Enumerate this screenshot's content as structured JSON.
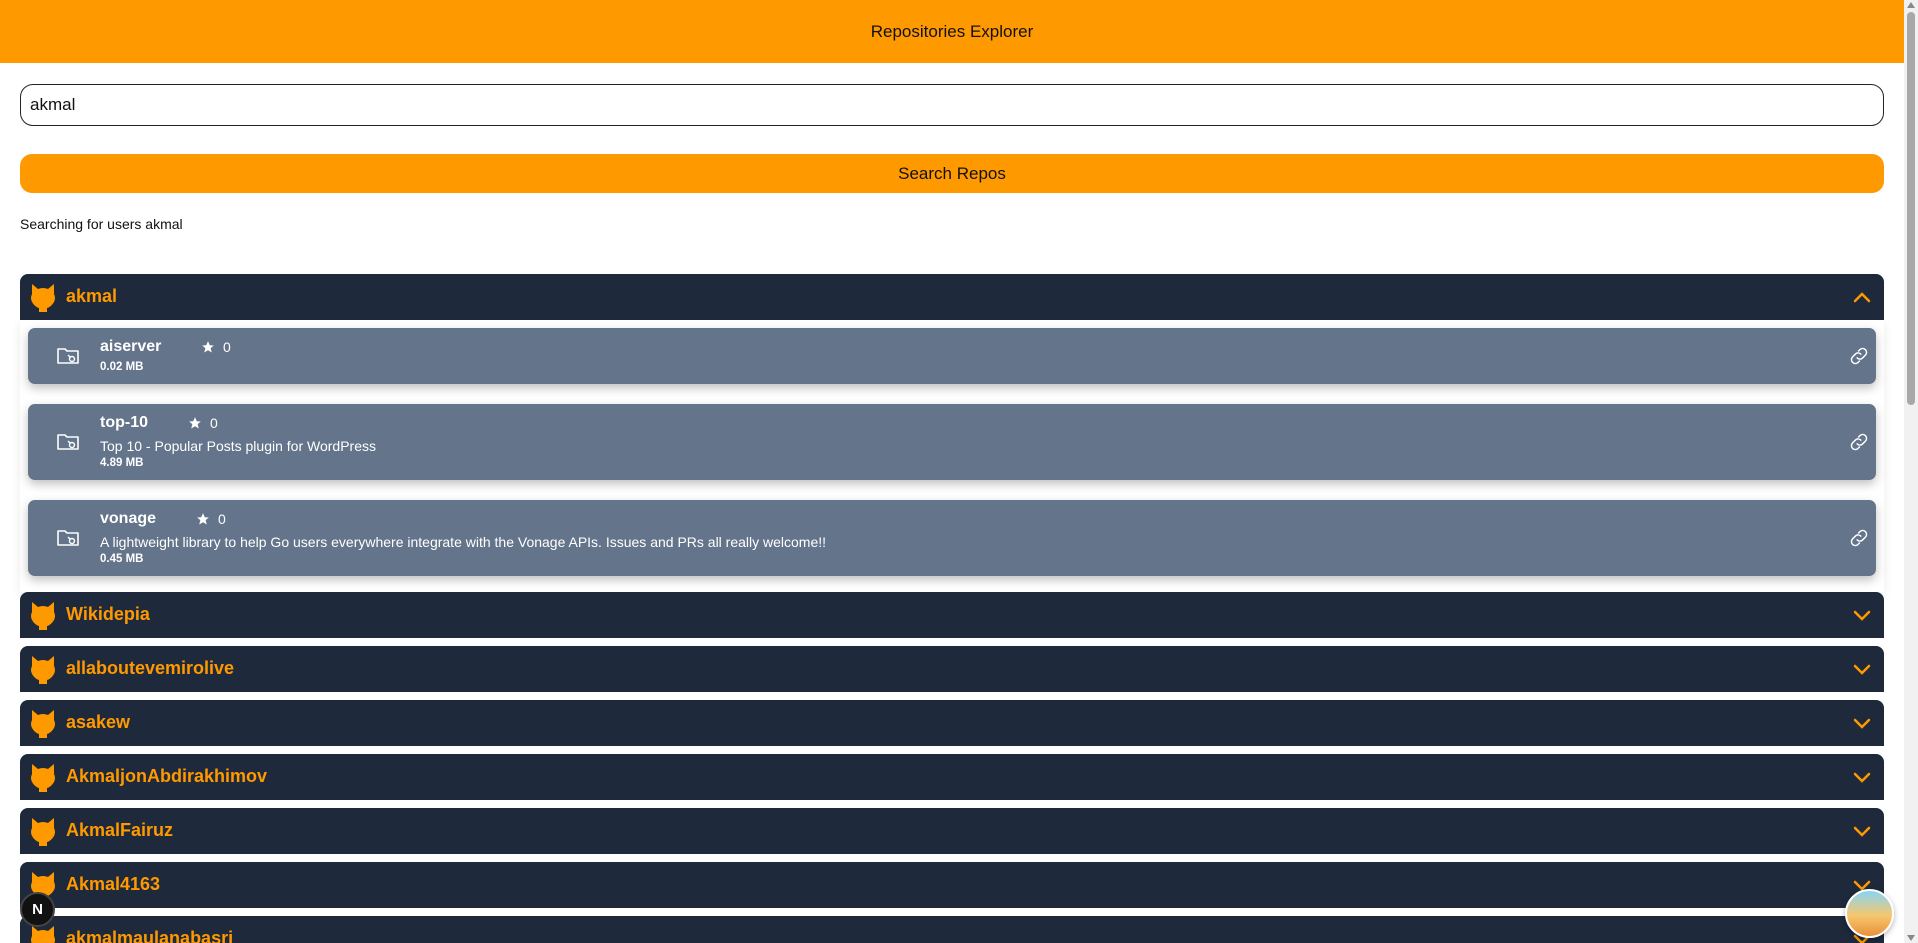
{
  "header": {
    "title": "Repositories Explorer"
  },
  "search": {
    "value": "akmal",
    "placeholder": ""
  },
  "button": {
    "label": "Search Repos"
  },
  "status": {
    "text": "Searching for users akmal"
  },
  "users": [
    {
      "name": "akmal"
    },
    {
      "name": "Wikidepia"
    },
    {
      "name": "allaboutevemirolive"
    },
    {
      "name": "asakew"
    },
    {
      "name": "AkmaljonAbdirakhimov"
    },
    {
      "name": "AkmalFairuz"
    },
    {
      "name": "Akmal4163"
    },
    {
      "name": "akmalmaulanabasri"
    }
  ],
  "repos": [
    {
      "name": "aiserver",
      "stars": "0",
      "description": "",
      "size": "0.02 MB"
    },
    {
      "name": "top-10",
      "stars": "0",
      "description": "Top 10 - Popular Posts plugin for WordPress",
      "size": "4.89 MB"
    },
    {
      "name": "vonage",
      "stars": "0",
      "description": "A lightweight library to help Go users everywhere integrate with the Vonage APIs. Issues and PRs all really welcome!!",
      "size": "0.45 MB"
    }
  ],
  "badge": {
    "label": "N"
  },
  "colors": {
    "accent": "#ff9900",
    "header_bg": "#1e293b",
    "repo_bg": "#64748b"
  },
  "icons": {
    "user": "github-icon",
    "repo": "folder-icon",
    "link": "link-icon",
    "star": "star-icon",
    "expand": "chevron-icon"
  }
}
